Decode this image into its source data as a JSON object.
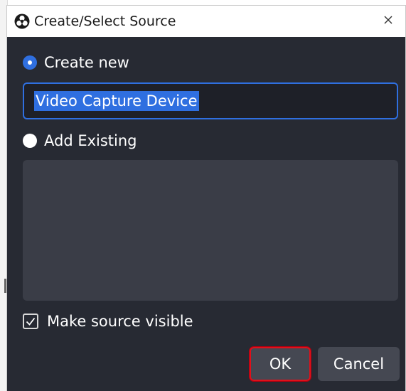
{
  "window": {
    "title": "Create/Select Source",
    "icon": "obs-logo-icon",
    "close_glyph": "×"
  },
  "create_new": {
    "label": "Create new",
    "selected": true
  },
  "name_input": {
    "value": "Video Capture Device",
    "selected_text": true
  },
  "add_existing": {
    "label": "Add Existing",
    "selected": false
  },
  "existing_sources": [],
  "make_visible": {
    "label": "Make source visible",
    "checked": true
  },
  "buttons": {
    "ok_label": "OK",
    "cancel_label": "Cancel"
  },
  "colors": {
    "dialog_bg": "#272a33",
    "accent": "#2f6fe0",
    "list_bg": "#3a3d47",
    "button_bg": "#454852",
    "highlight_outline": "#e0101a"
  }
}
